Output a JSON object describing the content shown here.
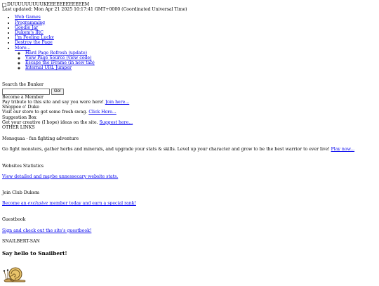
{
  "header": {
    "banner_text": "DUUUUUUUUUKEEEEEEEEEEEEM",
    "last_updated": "Last updated: Mon Apr 21 2025 10:17:41 GMT+0000 (Coordinated Universal Time)"
  },
  "nav": {
    "items": [
      "Web Games",
      "Programming",
      "Goodie Jar",
      "Dukem's IRC",
      "I'm Feeling Lucky",
      "Destroy the Page",
      "More..."
    ],
    "more_items": [
      "Hard Page Refresh (update)",
      "View Page Source (view code)",
      "Escape the iFrame (in new tab)",
      "Internal URL Jumper"
    ]
  },
  "search": {
    "label": "Search the Bunker",
    "placeholder": "",
    "button": "Go!"
  },
  "member": {
    "title": "Become a Member",
    "text": "Pay tribute to this site and say you were here!",
    "link": "Join here..."
  },
  "shop": {
    "title": "Shoppee o' Duke",
    "text": "Visit our store to get some fresh swag.",
    "link": "Click Here..."
  },
  "suggest": {
    "title": "Suggestion Box",
    "text": "Get your creative (I hope) ideas on the site.",
    "link": "Suggest here..."
  },
  "other_links": {
    "title": "OTHER LINKS",
    "monsquaa_title": "Monsquaa - fun fighting adventure",
    "monsquaa_text": "Go fight monsters, gather herbs and minerals, and upgrade your stats & skills. Level up your character and grow to be the best warrior to ever live!",
    "monsquaa_link": "Play now...",
    "stats_title": "Websites Statistics",
    "stats_link": "View detailed and maybe unnessecary website stats.",
    "club_title": "Join Club Dukem",
    "club_link_a": "Become an ",
    "club_link_em": "exclusive",
    "club_link_b": " member today and earn a special rank!",
    "guestbook_title": "Guestbook",
    "guestbook_link": "Sign and check out the site's guestbook!"
  },
  "snail": {
    "title": "SNAILBERT-SAN",
    "hello": "Say hello to Snailbert!",
    "icon": "snail-icon"
  }
}
